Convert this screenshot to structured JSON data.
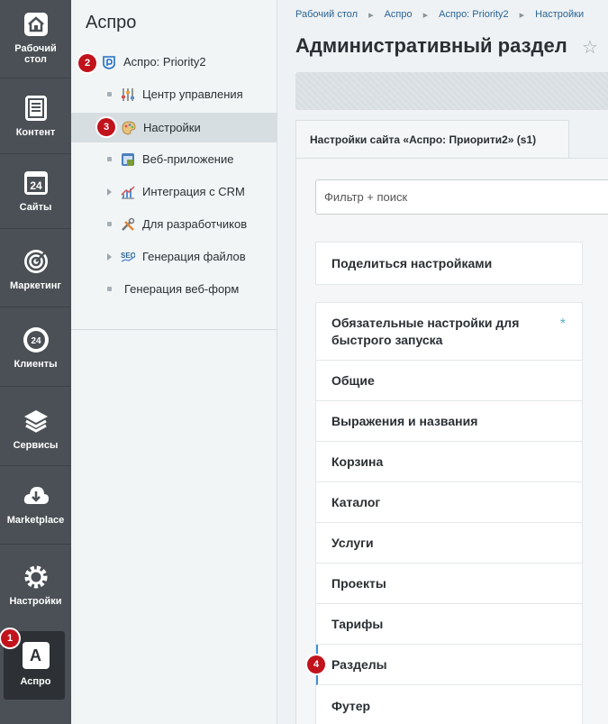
{
  "rail": {
    "items": [
      {
        "label": "Рабочий стол",
        "icon": "home-icon"
      },
      {
        "label": "Контент",
        "icon": "document-icon"
      },
      {
        "label": "Сайты",
        "icon": "calendar-24-icon"
      },
      {
        "label": "Маркетинг",
        "icon": "target-icon"
      },
      {
        "label": "Клиенты",
        "icon": "clients-24-icon"
      },
      {
        "label": "Сервисы",
        "icon": "layers-icon"
      },
      {
        "label": "Marketplace",
        "icon": "cloud-download-icon"
      },
      {
        "label": "Настройки",
        "icon": "gear-icon"
      },
      {
        "label": "Аспро",
        "icon": "aspro-a-icon",
        "glyph": "A"
      }
    ]
  },
  "menu": {
    "title": "Аспро",
    "items": [
      {
        "label": "Аспро: Priority2"
      },
      {
        "label": "Центр управления"
      },
      {
        "label": "Настройки"
      },
      {
        "label": "Веб-приложение"
      },
      {
        "label": "Интеграция с CRM"
      },
      {
        "label": "Для разработчиков"
      },
      {
        "label": "Генерация файлов"
      },
      {
        "label": "Генерация веб-форм"
      }
    ]
  },
  "badges": [
    "1",
    "2",
    "3",
    "4"
  ],
  "breadcrumbs": [
    "Рабочий стол",
    "Аспро",
    "Аспро: Priority2",
    "Настройки"
  ],
  "page": {
    "title": "Административный раздел",
    "tab_label": "Настройки сайта «Аспро: Приорити2» (s1)",
    "filter_placeholder": "Фильтр + поиск"
  },
  "share": {
    "label": "Поделиться настройками"
  },
  "settings_list": [
    {
      "label": "Обязательные настройки для быстрого запуска",
      "required_mark": "*"
    },
    {
      "label": "Общие"
    },
    {
      "label": "Выражения и названия"
    },
    {
      "label": "Корзина"
    },
    {
      "label": "Каталог"
    },
    {
      "label": "Услуги"
    },
    {
      "label": "Проекты"
    },
    {
      "label": "Тарифы"
    },
    {
      "label": "Разделы"
    },
    {
      "label": "Футер"
    }
  ],
  "colors": {
    "rail_bg": "#4a5055",
    "badge": "#c1131c",
    "link": "#2a6496",
    "selected_marker": "#3c8fd6"
  }
}
